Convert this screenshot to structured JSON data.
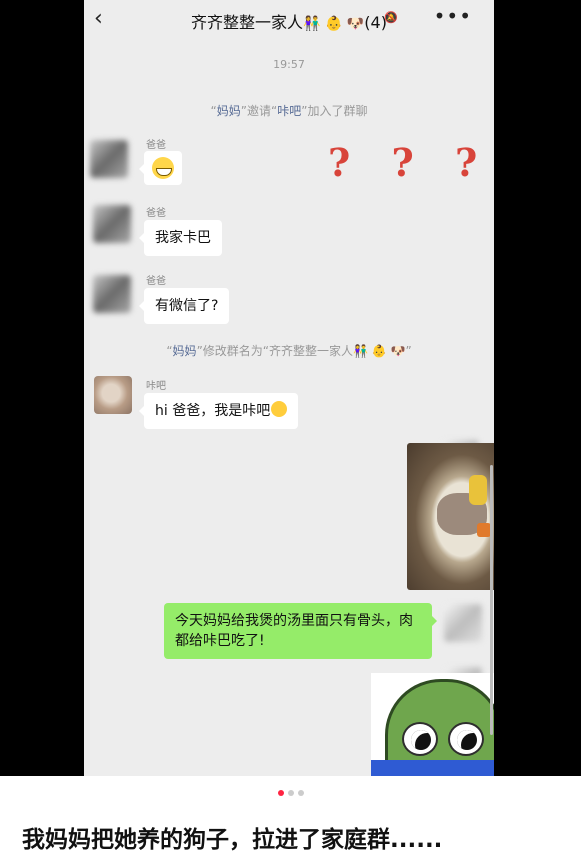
{
  "header": {
    "title": "齐齐整整一家人",
    "title_emojis": "👫 👶 🐶",
    "member_count": "(4)",
    "back_icon": "back-arrow-icon",
    "mute_icon": "mute-bell-icon",
    "more_icon": "more-icon"
  },
  "chat": {
    "timestamp": "19:57",
    "system_invite": {
      "quote_open": "“",
      "inviter": "妈妈",
      "quote_mid": "”邀请“",
      "invitee": "咔吧",
      "rest": "”加入了群聊"
    },
    "messages": [
      {
        "sender": "爸爸",
        "type": "emoji",
        "emoji": "grin-emoji"
      },
      {
        "sender": "爸爸",
        "text": "我家卡巴"
      },
      {
        "sender": "爸爸",
        "text": "有微信了?"
      },
      {
        "sender": "咔吧",
        "text": "hi 爸爸，我是咔吧",
        "emoji": "wink-emoji"
      },
      {
        "sender": "me",
        "type": "image",
        "image": "soup-photo"
      },
      {
        "sender": "me",
        "text": "今天妈妈给我煲的汤里面只有骨头，肉都给咔巴吃了!"
      },
      {
        "sender": "me",
        "type": "sticker",
        "image": "crying-frog-sticker"
      }
    ],
    "system_rename": {
      "quote_open": "“",
      "actor": "妈妈",
      "rest": "”修改群名为“齐齐整整一家人👫 👶 🐶”"
    },
    "overlay_marks": "? ? ? ? ?"
  },
  "footer": {
    "page_indicator": {
      "current": 1,
      "total": 3
    },
    "caption": "我妈妈把她养的狗子，拉进了家庭群......"
  },
  "colors": {
    "chat_bg": "#ededed",
    "outgoing_bubble": "#95ec69",
    "incoming_bubble": "#ffffff",
    "highlight_name": "#576b95",
    "question_marks": "#d8443a",
    "active_dot": "#ff2442"
  }
}
